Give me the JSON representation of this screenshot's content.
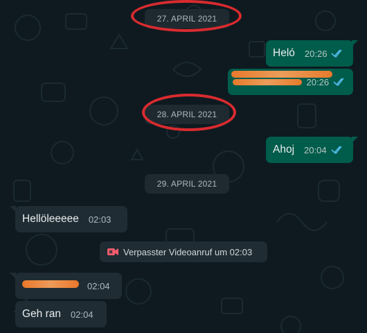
{
  "dates": [
    "27. APRIL 2021",
    "28. APRIL 2021",
    "29. APRIL 2021"
  ],
  "messages": [
    {
      "dir": "out",
      "text": "Heló",
      "time": "20:26",
      "status": "read"
    },
    {
      "dir": "out",
      "text": "",
      "time": "20:26",
      "status": "read",
      "redacted": true
    },
    {
      "dir": "out",
      "text": "Ahoj",
      "time": "20:04",
      "status": "read"
    },
    {
      "dir": "in",
      "text": "Hellöleeeee",
      "time": "02:03"
    },
    {
      "dir": "in",
      "text": "",
      "time": "02:04",
      "redacted": true
    },
    {
      "dir": "in",
      "text": "Geh ran",
      "time": "02:04"
    }
  ],
  "missed_call": {
    "text": "Verpasster Videoanruf um 02:03",
    "icon": "missed-video-call-icon",
    "color": "#f15c6d"
  },
  "colors": {
    "outgoing": "#005c4b",
    "incoming": "#1f2c33",
    "read_ticks": "#53bdeb",
    "annotation": "#d92b2f",
    "redaction": "#f47b2a"
  }
}
